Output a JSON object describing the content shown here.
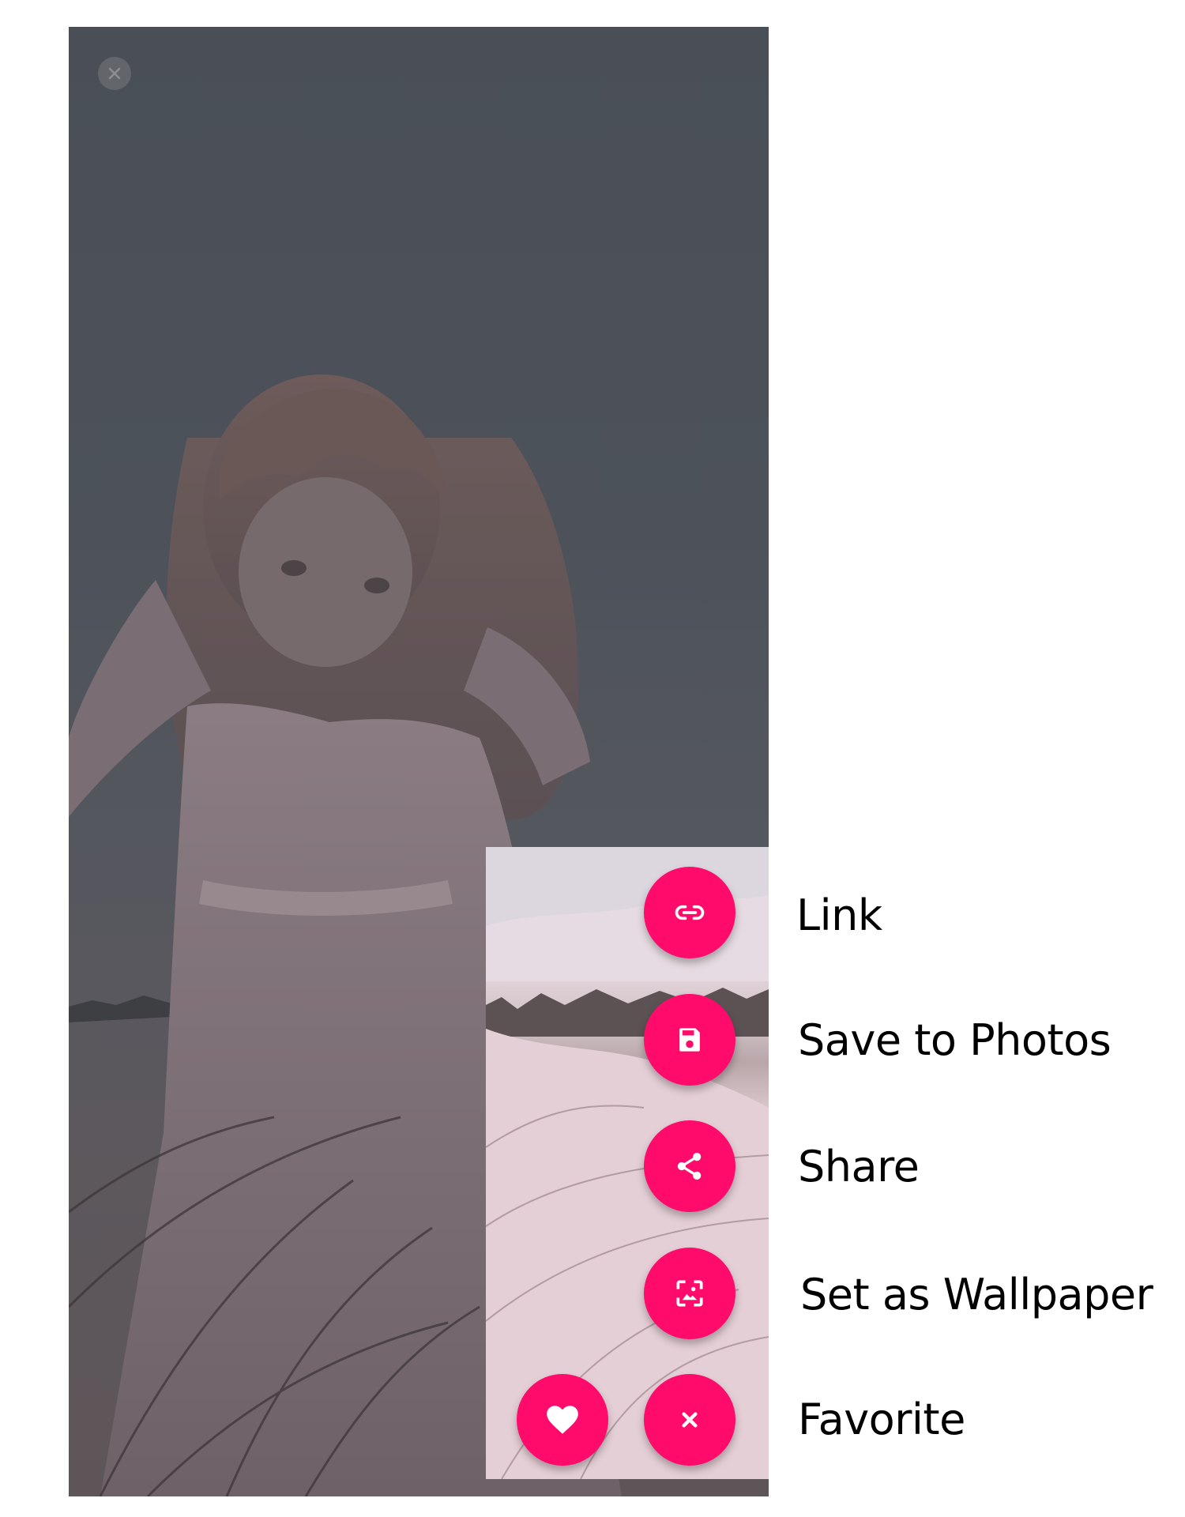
{
  "screen": {
    "close_icon": "close-icon"
  },
  "actions": [
    {
      "id": "link",
      "label": "Link",
      "icon": "link-icon"
    },
    {
      "id": "save",
      "label": "Save to Photos",
      "icon": "floppy-disk-icon"
    },
    {
      "id": "share",
      "label": "Share",
      "icon": "share-icon"
    },
    {
      "id": "wallpaper",
      "label": "Set as Wallpaper",
      "icon": "wallpaper-icon"
    },
    {
      "id": "favorite",
      "label": "Favorite",
      "icon": "heart-icon"
    }
  ],
  "menu_toggle": {
    "icon": "close-icon"
  },
  "colors": {
    "accent": "#fe0b6c",
    "overlay": "#4d525a",
    "label_text": "#000000"
  }
}
